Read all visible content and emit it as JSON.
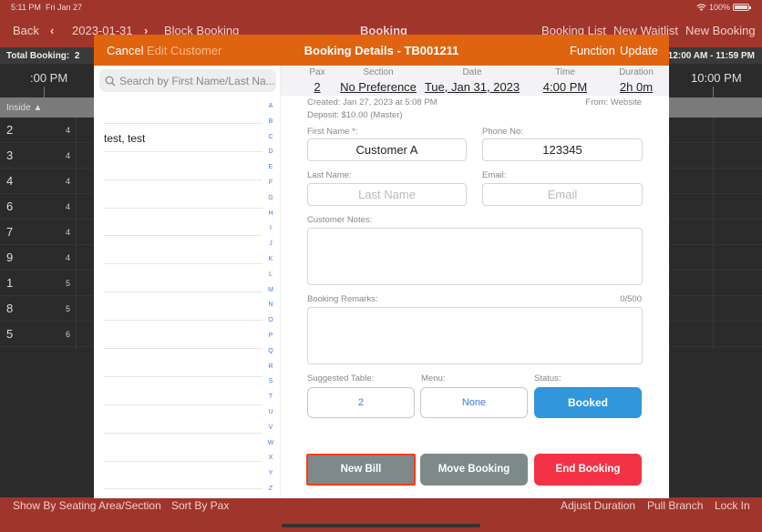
{
  "status_bar": {
    "time": "5:11 PM",
    "date": "Fri Jan 27",
    "battery": "100%",
    "battery_level_percent": 100
  },
  "nav": {
    "back": "Back",
    "date": "2023-01-31",
    "block_booking": "Block Booking",
    "title": "Booking",
    "booking_list": "Booking List",
    "new_waitlist": "New Waitlist",
    "new_booking": "New Booking"
  },
  "timeline": {
    "total_booking_label": "Total Booking:",
    "total_booking_value": "2",
    "range": "12:00 AM - 11:59 PM",
    "times": [
      ":00 PM",
      "10:00 PM"
    ],
    "section": "Inside",
    "tables": [
      {
        "number": "2",
        "capacity": "4"
      },
      {
        "number": "3",
        "capacity": "4"
      },
      {
        "number": "4",
        "capacity": "4"
      },
      {
        "number": "6",
        "capacity": "4"
      },
      {
        "number": "7",
        "capacity": "4"
      },
      {
        "number": "9",
        "capacity": "4"
      },
      {
        "number": "1",
        "capacity": "5"
      },
      {
        "number": "8",
        "capacity": "5"
      },
      {
        "number": "5",
        "capacity": "6"
      }
    ]
  },
  "bottom": {
    "show_by": "Show By Seating Area/Section",
    "sort_by": "Sort By Pax",
    "adjust_duration": "Adjust Duration",
    "pull_branch": "Pull Branch",
    "lock_in": "Lock In"
  },
  "modal": {
    "cancel": "Cancel",
    "edit_customer": "Edit Customer",
    "title": "Booking Details - TB001211",
    "function": "Function",
    "update": "Update",
    "search_placeholder": "Search by First Name/Last Na...",
    "customers": [
      "",
      "test, test",
      "",
      "",
      "",
      "",
      "",
      "",
      "",
      "",
      "",
      "",
      "",
      ""
    ],
    "alphabet": [
      "A",
      "B",
      "C",
      "D",
      "E",
      "F",
      "G",
      "H",
      "I",
      "J",
      "K",
      "L",
      "M",
      "N",
      "O",
      "P",
      "Q",
      "R",
      "S",
      "T",
      "U",
      "V",
      "W",
      "X",
      "Y",
      "Z"
    ],
    "summary": {
      "pax_label": "Pax",
      "pax": "2",
      "section_label": "Section",
      "section": "No Preference",
      "date_label": "Date",
      "date": "Tue, Jan 31, 2023",
      "time_label": "Time",
      "time": "4:00 PM",
      "duration_label": "Duration",
      "duration": "2h 0m"
    },
    "created": "Created: Jan 27, 2023 at 5:08 PM",
    "from": "From: Website",
    "deposit": "Deposit: $10.00 (Master)",
    "first_name_label": "First Name *:",
    "first_name": "Customer A",
    "phone_label": "Phone No:",
    "phone": "123345",
    "last_name_label": "Last Name:",
    "last_name_placeholder": "Last Name",
    "email_label": "Email:",
    "email_placeholder": "Email",
    "notes_label": "Customer Notes:",
    "remarks_label": "Booking Remarks:",
    "remarks_count": "0/500",
    "suggested_table_label": "Suggested Table:",
    "suggested_table": "2",
    "menu_label": "Menu:",
    "menu": "None",
    "status_label": "Status:",
    "status": "Booked",
    "new_bill": "New Bill",
    "move_booking": "Move Booking",
    "end_booking": "End Booking"
  },
  "colors": {
    "nav_red": "#a0352c",
    "modal_orange": "#e0640f",
    "status_blue": "#3196da",
    "button_gray": "#7d8a89",
    "end_red": "#f43246",
    "focus_outline": "#ff3b1a"
  }
}
